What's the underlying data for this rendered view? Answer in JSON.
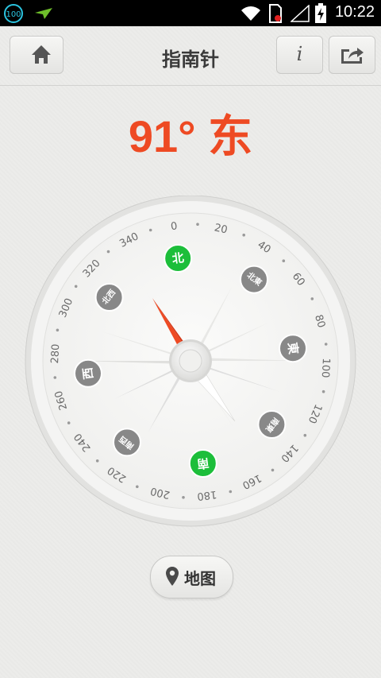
{
  "status_bar": {
    "time": "10:22",
    "notification_badge": "100"
  },
  "header": {
    "title": "指南针",
    "info_label": "i"
  },
  "heading": {
    "degree": "91°",
    "direction": "东"
  },
  "compass": {
    "ticks": [
      "0",
      "20",
      "40",
      "60",
      "80",
      "100",
      "120",
      "140",
      "160",
      "180",
      "200",
      "220",
      "240",
      "260",
      "280",
      "300",
      "320",
      "340"
    ],
    "directions": [
      "北",
      "北東",
      "東",
      "南東",
      "南",
      "南西",
      "西",
      "北西"
    ],
    "needle_heading_deg": 91
  },
  "map_button": {
    "label": "地图"
  },
  "colors": {
    "accent": "#ee4a23",
    "green": "#1cbe3a",
    "badge": "#888888"
  }
}
